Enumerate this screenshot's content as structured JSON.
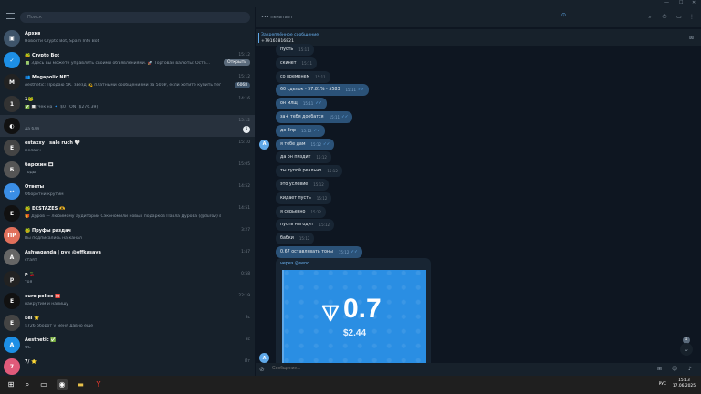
{
  "window": {
    "controls": [
      "—",
      "☐",
      "✕"
    ]
  },
  "sidebar": {
    "search_placeholder": "Поиск",
    "chats": [
      {
        "name": "Архив",
        "preview": "Новости Crypto Bot, Spam Info Bot",
        "time": "",
        "badge": "",
        "color": "#3e546a",
        "initial": "▣"
      },
      {
        "name": "🐸 Crypto Bot",
        "preview": "📗 Здесь вы можете управлять своими объявлениями. 🚀 Торговая валюты: Оста...",
        "time": "15:12",
        "badge": "",
        "button": "Открыть",
        "color": "#1d8fe6",
        "initial": "✓"
      },
      {
        "name": "👥 Megapolic NFT",
        "preview": "Aesthetic: Продаю 5К. звёзд 💫 платными сообщениями за 500₽, если хотите купить тег...",
        "time": "15:12",
        "badge": "6068",
        "color": "#222",
        "initial": "M"
      },
      {
        "name": "1🐸",
        "preview": "✅ 🔲 Чек на 🔹 $0 TON ($276.39)",
        "time": "14:16",
        "badge": "",
        "color": "#333",
        "initial": "1"
      },
      {
        "name": "",
        "preview": "да бля",
        "time": "15:12",
        "badge": "1",
        "color": "#111",
        "initial": "◐",
        "active": true
      },
      {
        "name": "estaxxy | sale ruch 🤍",
        "preview": "меланч",
        "time": "15:10",
        "badge": "",
        "color": "#444",
        "initial": "E"
      },
      {
        "name": "барскин 🎞",
        "preview": "Тоды",
        "time": "15:05",
        "badge": "",
        "color": "#555",
        "initial": "Б"
      },
      {
        "name": "Ответы",
        "preview": "Оборотни крутим",
        "time": "14:52",
        "badge": "",
        "color": "#3a8ee6",
        "initial": "↩"
      },
      {
        "name": "🐸 ECSTAZES 🫶",
        "preview": "🎁 Дуров — любимому аудитории Сэкономили новых подарков Павла Дурова (@durov) вишневая...",
        "time": "14:51",
        "badge": "",
        "color": "#111",
        "initial": "E"
      },
      {
        "name": "🐸 Пруфы раздач",
        "preview": "Вы подписались на канал",
        "time": "3:27",
        "badge": "",
        "color": "#e1705b",
        "initial": "ПР"
      },
      {
        "name": "Ashvaganda | руч @offkasaya",
        "preview": "стаят",
        "time": "1:47",
        "badge": "",
        "color": "#666",
        "initial": "A"
      },
      {
        "name": "р 🍒",
        "preview": "тоя",
        "time": "0:58",
        "badge": "",
        "color": "#222",
        "initial": "р"
      },
      {
        "name": "euro police 🆘",
        "preview": "накрутим и напишу",
        "time": "22:19",
        "badge": "",
        "color": "#111",
        "initial": "E"
      },
      {
        "name": "Eel ⭐",
        "preview": "$726 оборот у меня давно еще",
        "time": "Вс",
        "badge": "",
        "color": "#444",
        "initial": "E"
      },
      {
        "name": "Aesthetic ✅",
        "preview": "ФЕ",
        "time": "Вс",
        "badge": "",
        "color": "#1d8fe6",
        "initial": "A"
      },
      {
        "name": "7/ ⭐",
        "preview": "",
        "time": "Пт",
        "badge": "",
        "color": "#e05a7a",
        "initial": "7"
      }
    ]
  },
  "header": {
    "typing": "••• печатает",
    "center_icon": "⊙"
  },
  "pinned": {
    "title": "Закреплённое сообщение",
    "text": "+79161816821"
  },
  "messages": [
    {
      "text": "пусть",
      "time": "15:11",
      "out": false
    },
    {
      "text": "скинет",
      "time": "15:11",
      "out": false
    },
    {
      "text": "со временем",
      "time": "15:11",
      "out": false
    },
    {
      "text": "60 сделок - 57.81% - $583",
      "time": "15:11",
      "out": true
    },
    {
      "text": "он млщ",
      "time": "15:11",
      "out": true
    },
    {
      "text": "за+ тебя доебатся",
      "time": "15:11",
      "out": true
    },
    {
      "text": "до 3пр",
      "time": "15:12",
      "out": true
    },
    {
      "text": "я тебе дам",
      "time": "15:12",
      "out": true
    },
    {
      "text": "да он пиздит",
      "time": "15:12",
      "out": false
    },
    {
      "text": "ты тупой реально",
      "time": "15:12",
      "out": false
    },
    {
      "text": "это условие",
      "time": "15:12",
      "out": false
    },
    {
      "text": "кидает пусть",
      "time": "15:12",
      "out": false
    },
    {
      "text": "я серьезно",
      "time": "15:12",
      "out": false
    },
    {
      "text": "пусть нагодит",
      "time": "15:12",
      "out": false
    },
    {
      "text": "бабки",
      "time": "15:12",
      "out": false
    },
    {
      "text": "0.67 оставлявать тоны",
      "time": "15:12",
      "out": true
    }
  ],
  "card": {
    "via": "через @send",
    "amount": "0.7",
    "usd": "$2.44"
  },
  "avatar_letter": "A",
  "unread_count": "1",
  "compose": {
    "placeholder": "Сообщение..."
  },
  "taskbar": {
    "lang": "РУС",
    "time": "15:13",
    "date": "17.06.2025"
  }
}
